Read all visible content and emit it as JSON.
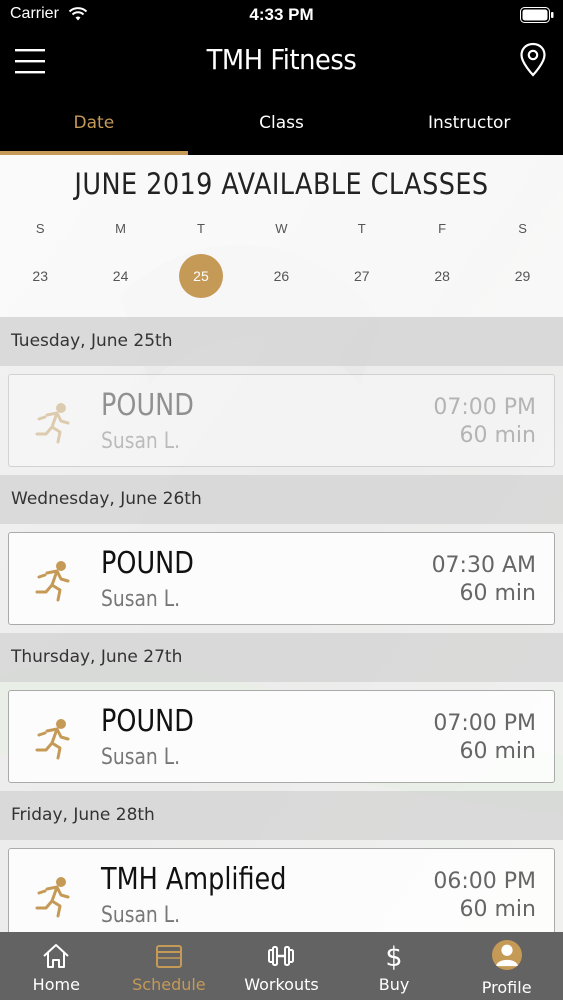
{
  "status": {
    "carrier": "Carrier",
    "time": "4:33 PM"
  },
  "nav": {
    "title": "TMH Fitness"
  },
  "tabs": [
    {
      "label": "Date"
    },
    {
      "label": "Class"
    },
    {
      "label": "Instructor"
    }
  ],
  "calendar": {
    "title": "JUNE 2019 AVAILABLE CLASSES",
    "weekdays": [
      "S",
      "M",
      "T",
      "W",
      "T",
      "F",
      "S"
    ],
    "dates": [
      "23",
      "24",
      "25",
      "26",
      "27",
      "28",
      "29"
    ],
    "selected": "25"
  },
  "days": [
    {
      "header": "Tuesday, June 25th",
      "class": {
        "name": "POUND",
        "instructor": "Susan L.",
        "time": "07:00 PM",
        "duration": "60 min"
      }
    },
    {
      "header": "Wednesday, June 26th",
      "class": {
        "name": "POUND",
        "instructor": "Susan L.",
        "time": "07:30 AM",
        "duration": "60 min"
      }
    },
    {
      "header": "Thursday, June 27th",
      "class": {
        "name": "POUND",
        "instructor": "Susan L.",
        "time": "07:00 PM",
        "duration": "60 min"
      }
    },
    {
      "header": "Friday, June 28th",
      "class": {
        "name": "TMH Amplified",
        "instructor": "Susan L.",
        "time": "06:00 PM",
        "duration": "60 min"
      }
    }
  ],
  "bottom_nav": [
    {
      "label": "Home",
      "icon": "home-icon"
    },
    {
      "label": "Schedule",
      "icon": "calendar-icon"
    },
    {
      "label": "Workouts",
      "icon": "dumbbell-icon"
    },
    {
      "label": "Buy",
      "icon": "dollar-icon"
    },
    {
      "label": "Profile",
      "icon": "avatar"
    }
  ],
  "colors": {
    "accent": "#c59a57",
    "header_bg": "#000000",
    "tabbar_bg": "#636363"
  }
}
